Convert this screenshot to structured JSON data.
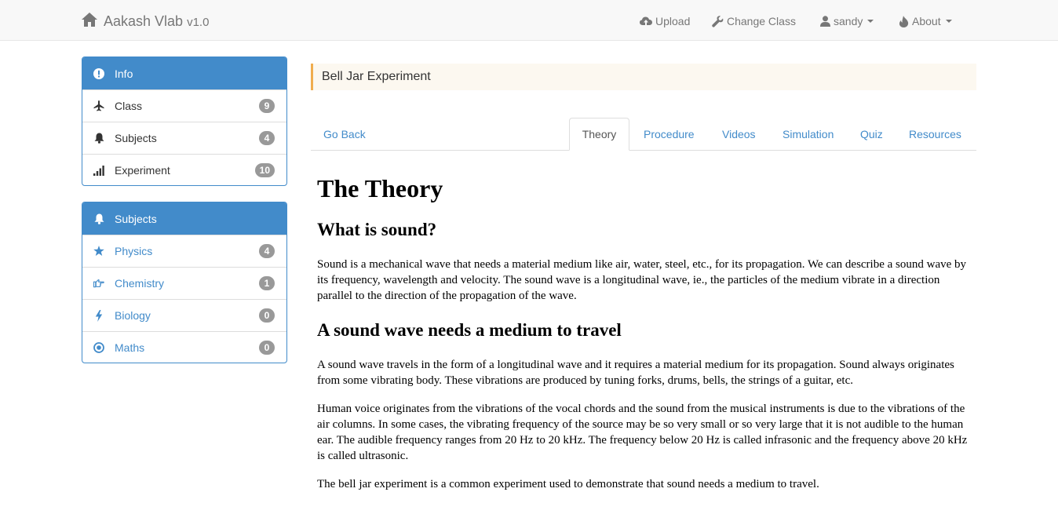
{
  "navbar": {
    "brand": "Aakash Vlab",
    "version": "v1.0",
    "upload": "Upload",
    "change_class": "Change Class",
    "user": "sandy",
    "about": "About"
  },
  "info_panel": {
    "title": "Info",
    "items": [
      {
        "label": "Class",
        "count": "9",
        "icon": "plane-icon"
      },
      {
        "label": "Subjects",
        "count": "4",
        "icon": "bell-icon"
      },
      {
        "label": "Experiment",
        "count": "10",
        "icon": "signal-icon"
      }
    ]
  },
  "subjects_panel": {
    "title": "Subjects",
    "items": [
      {
        "label": "Physics",
        "count": "4",
        "icon": "star-icon"
      },
      {
        "label": "Chemistry",
        "count": "1",
        "icon": "hand-right-icon"
      },
      {
        "label": "Biology",
        "count": "0",
        "icon": "flash-icon"
      },
      {
        "label": "Maths",
        "count": "0",
        "icon": "record-icon"
      }
    ]
  },
  "experiment_title": "Bell Jar Experiment",
  "tabs": {
    "go_back": "Go Back",
    "theory": "Theory",
    "procedure": "Procedure",
    "videos": "Videos",
    "simulation": "Simulation",
    "quiz": "Quiz",
    "resources": "Resources"
  },
  "content": {
    "heading": "The Theory",
    "section1_title": "What is sound?",
    "section1_p1": "Sound is a mechanical wave that needs a material medium like air, water, steel, etc., for its propagation. We can describe a sound wave by its frequency, wavelength and velocity. The sound wave is a longitudinal wave, ie., the particles of the medium vibrate in a direction parallel to the direction of the propagation of the wave.",
    "section2_title": "A sound wave needs a medium to travel",
    "section2_p1": "A sound wave travels in the form of a longitudinal wave and it requires a material medium for its propagation.  Sound always originates from some vibrating body. These vibrations are produced by tuning forks, drums, bells, the strings of a guitar, etc.",
    "section2_p2": "Human voice originates from the vibrations of the vocal chords and the sound from the musical instruments is due to the vibrations of the air columns. In some cases, the vibrating frequency of the source may be so very small or so very large that it is not audible to the  human ear. The audible frequency ranges from 20 Hz to 20 kHz. The frequency below 20 Hz is called infrasonic and the frequency above 20 kHz is called ultrasonic.",
    "section2_p3": "The bell jar experiment is a common experiment used to demonstrate that sound needs a medium to travel."
  },
  "colors": {
    "primary": "#428bca",
    "badge": "#999999",
    "breadcrumb_bg": "#fcf8f0",
    "breadcrumb_accent": "#f0ad4e"
  }
}
